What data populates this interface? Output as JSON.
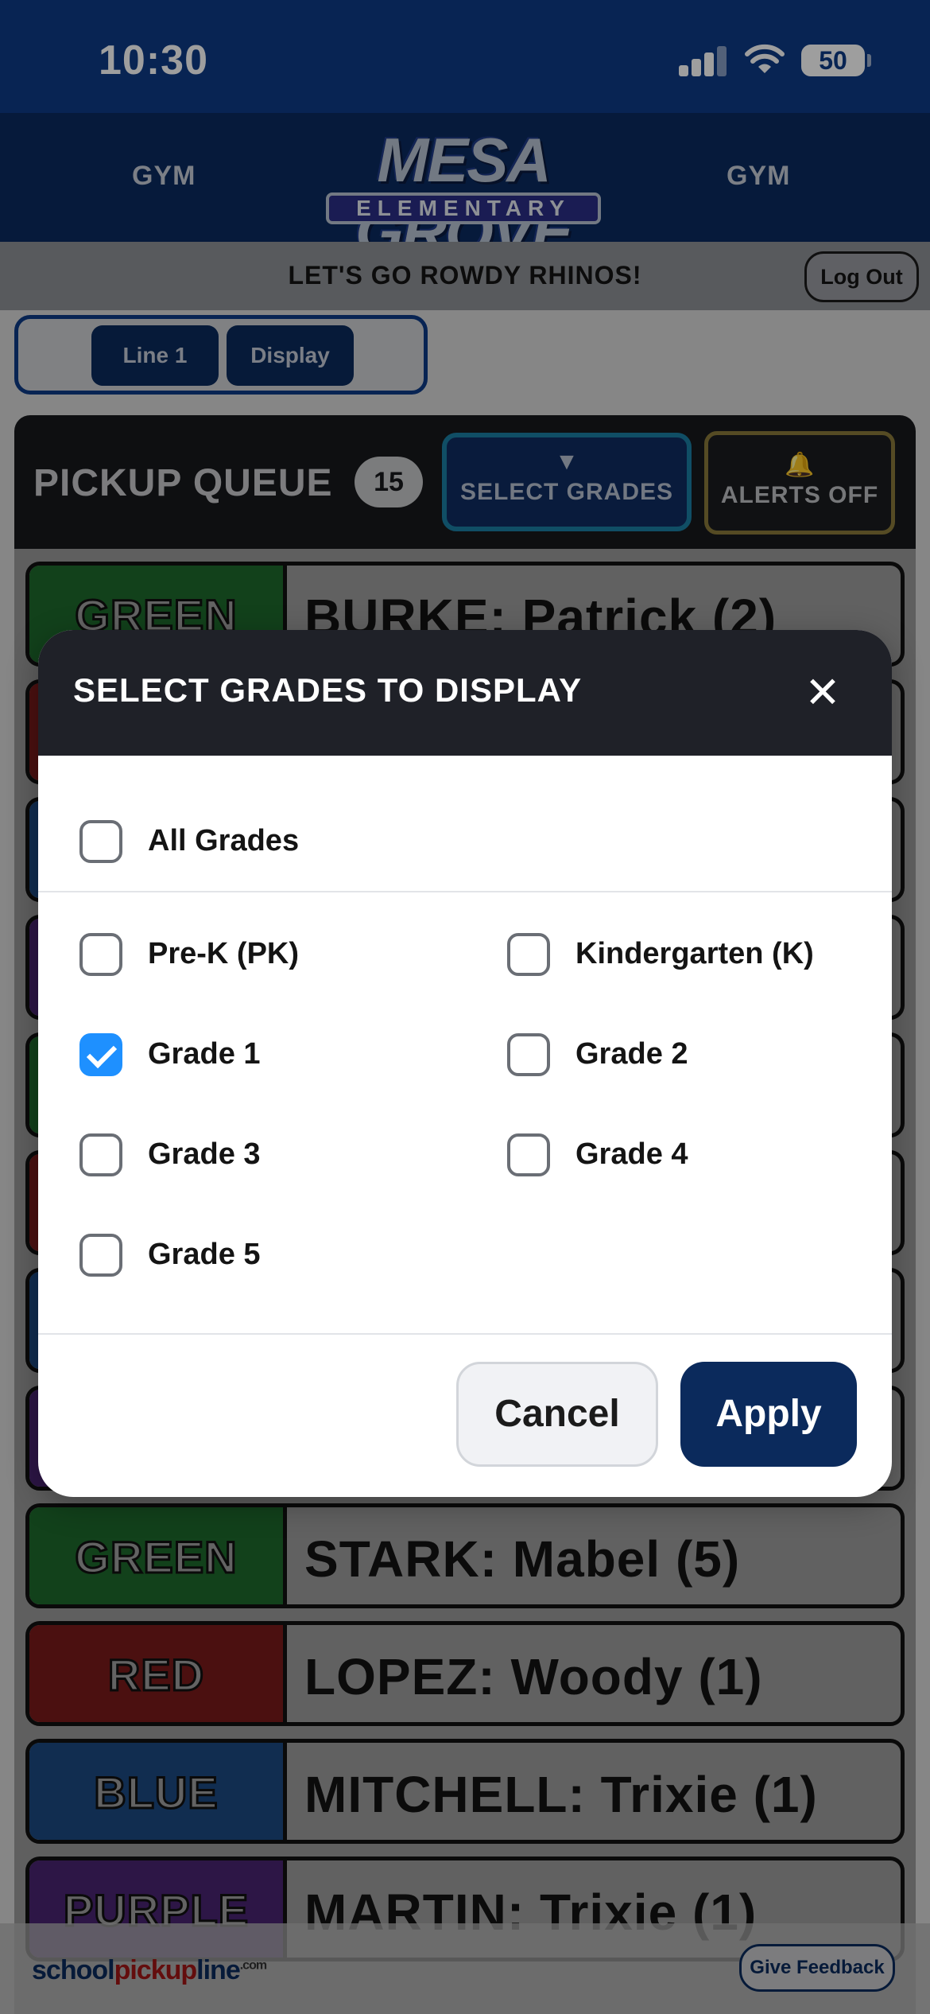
{
  "status": {
    "time": "10:30",
    "battery": "50"
  },
  "header": {
    "gym_left": "GYM",
    "gym_right": "GYM",
    "logo_top": "MESA GROVE",
    "logo_bottom": "ELEMENTARY"
  },
  "motto": "LET'S GO ROWDY RHINOS!",
  "logout": "Log Out",
  "tabs": [
    {
      "label": "Line 1"
    },
    {
      "label": "Display"
    }
  ],
  "queue": {
    "title": "PICKUP QUEUE",
    "count": "15",
    "select_arrow": "▼",
    "select_label": "SELECT GRADES",
    "alerts_icon": "bell-icon",
    "alerts_label": "ALERTS OFF",
    "items": [
      {
        "color": "GREEN",
        "name": "BURKE: Patrick (2)"
      },
      {
        "color": "RED",
        "name": ""
      },
      {
        "color": "BLUE",
        "name": ""
      },
      {
        "color": "PURPLE",
        "name": ""
      },
      {
        "color": "GREEN",
        "name": ""
      },
      {
        "color": "RED",
        "name": ""
      },
      {
        "color": "BLUE",
        "name": ""
      },
      {
        "color": "PURPLE",
        "name": ""
      },
      {
        "color": "GREEN",
        "name": "STARK: Mabel (5)"
      },
      {
        "color": "RED",
        "name": "LOPEZ: Woody (1)"
      },
      {
        "color": "BLUE",
        "name": "MITCHELL: Trixie (1)"
      },
      {
        "color": "PURPLE",
        "name": "MARTIN: Trixie (1)"
      }
    ]
  },
  "modal": {
    "title": "SELECT GRADES TO DISPLAY",
    "close_icon": "close-icon",
    "all_grades": {
      "label": "All Grades",
      "checked": false
    },
    "grades": [
      {
        "label": "Pre-K (PK)",
        "checked": false
      },
      {
        "label": "Kindergarten (K)",
        "checked": false
      },
      {
        "label": "Grade 1",
        "checked": true
      },
      {
        "label": "Grade 2",
        "checked": false
      },
      {
        "label": "Grade 3",
        "checked": false
      },
      {
        "label": "Grade 4",
        "checked": false
      },
      {
        "label": "Grade 5",
        "checked": false
      }
    ],
    "cancel": "Cancel",
    "apply": "Apply"
  },
  "footer": {
    "brand_school": "school",
    "brand_pickup": "pickup",
    "brand_line": "line",
    "brand_com": ".com",
    "feedback": "Give Feedback"
  },
  "colors": {
    "primary": "#0b2a5c",
    "check": "#1e90ff",
    "green": "#1e6a2c",
    "red": "#7a1a1a",
    "blue": "#1c4a82",
    "purple": "#4a2472"
  }
}
